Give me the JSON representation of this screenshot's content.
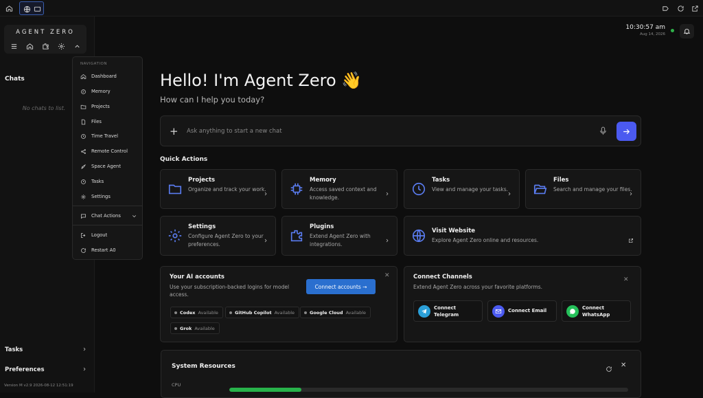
{
  "app": {
    "brand": "AGENT ZERO"
  },
  "sidebar": {
    "chats_heading": "Chats",
    "empty_text": "No chats to list.",
    "tasks_label": "Tasks",
    "preferences_label": "Preferences",
    "version": "Version M v2.9 2026-08-12 12:51:19"
  },
  "nav_menu": {
    "heading": "NAVIGATION",
    "items": [
      {
        "label": "Dashboard",
        "icon": "home-icon"
      },
      {
        "label": "Memory",
        "icon": "memory-icon"
      },
      {
        "label": "Projects",
        "icon": "projects-icon"
      },
      {
        "label": "Files",
        "icon": "files-icon"
      },
      {
        "label": "Time Travel",
        "icon": "time-travel-icon"
      },
      {
        "label": "Remote Control",
        "icon": "remote-control-icon"
      },
      {
        "label": "Space Agent",
        "icon": "rocket-icon"
      },
      {
        "label": "Tasks",
        "icon": "tasks-icon"
      },
      {
        "label": "Settings",
        "icon": "settings-icon"
      }
    ],
    "chat_actions": "Chat Actions",
    "logout": "Logout",
    "restart": "Restart A0"
  },
  "header": {
    "time": "10:30:57 am",
    "date": "Aug 14, 2026"
  },
  "main": {
    "greeting": "Hello! I'm Agent Zero 👋",
    "subtitle": "How can I help you today?",
    "chat_placeholder": "Ask anything to start a new chat",
    "quick_actions_heading": "Quick Actions",
    "quick_actions": [
      {
        "title": "Projects",
        "desc": "Organize and track your work.",
        "icon": "folder-icon"
      },
      {
        "title": "Memory",
        "desc": "Access saved context and knowledge.",
        "icon": "chip-icon"
      },
      {
        "title": "Tasks",
        "desc": "View and manage your tasks.",
        "icon": "clock-icon"
      },
      {
        "title": "Files",
        "desc": "Search and manage your files.",
        "icon": "folder-open-icon"
      },
      {
        "title": "Settings",
        "desc": "Configure Agent Zero to your preferences.",
        "icon": "gear-icon"
      },
      {
        "title": "Plugins",
        "desc": "Extend Agent Zero with integrations.",
        "icon": "puzzle-icon"
      },
      {
        "title": "Visit Website",
        "desc": "Explore Agent Zero online and resources.",
        "icon": "globe-icon"
      }
    ],
    "ai_accounts": {
      "title": "Your AI accounts",
      "desc": "Use your subscription-backed logins for model access.",
      "connect_label": "Connect accounts →",
      "accounts": [
        {
          "name": "Codex",
          "status": "Available"
        },
        {
          "name": "GitHub Copilot",
          "status": "Available"
        },
        {
          "name": "Google Cloud",
          "status": "Available"
        },
        {
          "name": "Grok",
          "status": "Available"
        }
      ]
    },
    "channels": {
      "title": "Connect Channels",
      "desc": "Extend Agent Zero across your favorite platforms.",
      "items": [
        {
          "label": "Connect Telegram",
          "color": "#2a9fd8"
        },
        {
          "label": "Connect Email",
          "color": "#4b5af0"
        },
        {
          "label": "Connect WhatsApp",
          "color": "#25c05a"
        }
      ]
    },
    "system_resources": {
      "title": "System Resources",
      "cpu_label": "CPU",
      "cpu_fraction": 0.18
    }
  },
  "colors": {
    "accent": "#4b5af0",
    "icon_blue": "#5a7cf0",
    "status_green": "#2fb24a",
    "connect_button": "#2a6fcf"
  }
}
